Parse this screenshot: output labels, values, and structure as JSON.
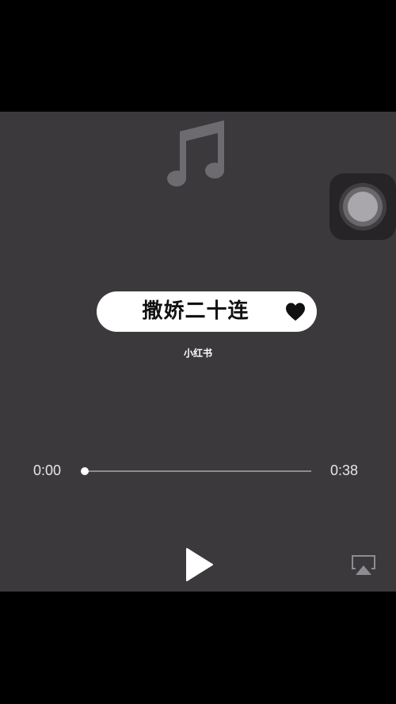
{
  "player": {
    "title": "撒娇二十连",
    "watermark": "小红书",
    "time_elapsed": "0:00",
    "time_total": "0:38",
    "progress": 0.0,
    "icons": {
      "artwork": "music-note-icon",
      "favorite": "heart-icon",
      "play": "play-icon",
      "airplay": "airplay-icon",
      "assistive_touch": "assistive-touch-icon"
    }
  },
  "colors": {
    "background": "#3c393d",
    "pill": "#ffffff",
    "track": "#8e8c90",
    "accent": "#ffffff"
  }
}
